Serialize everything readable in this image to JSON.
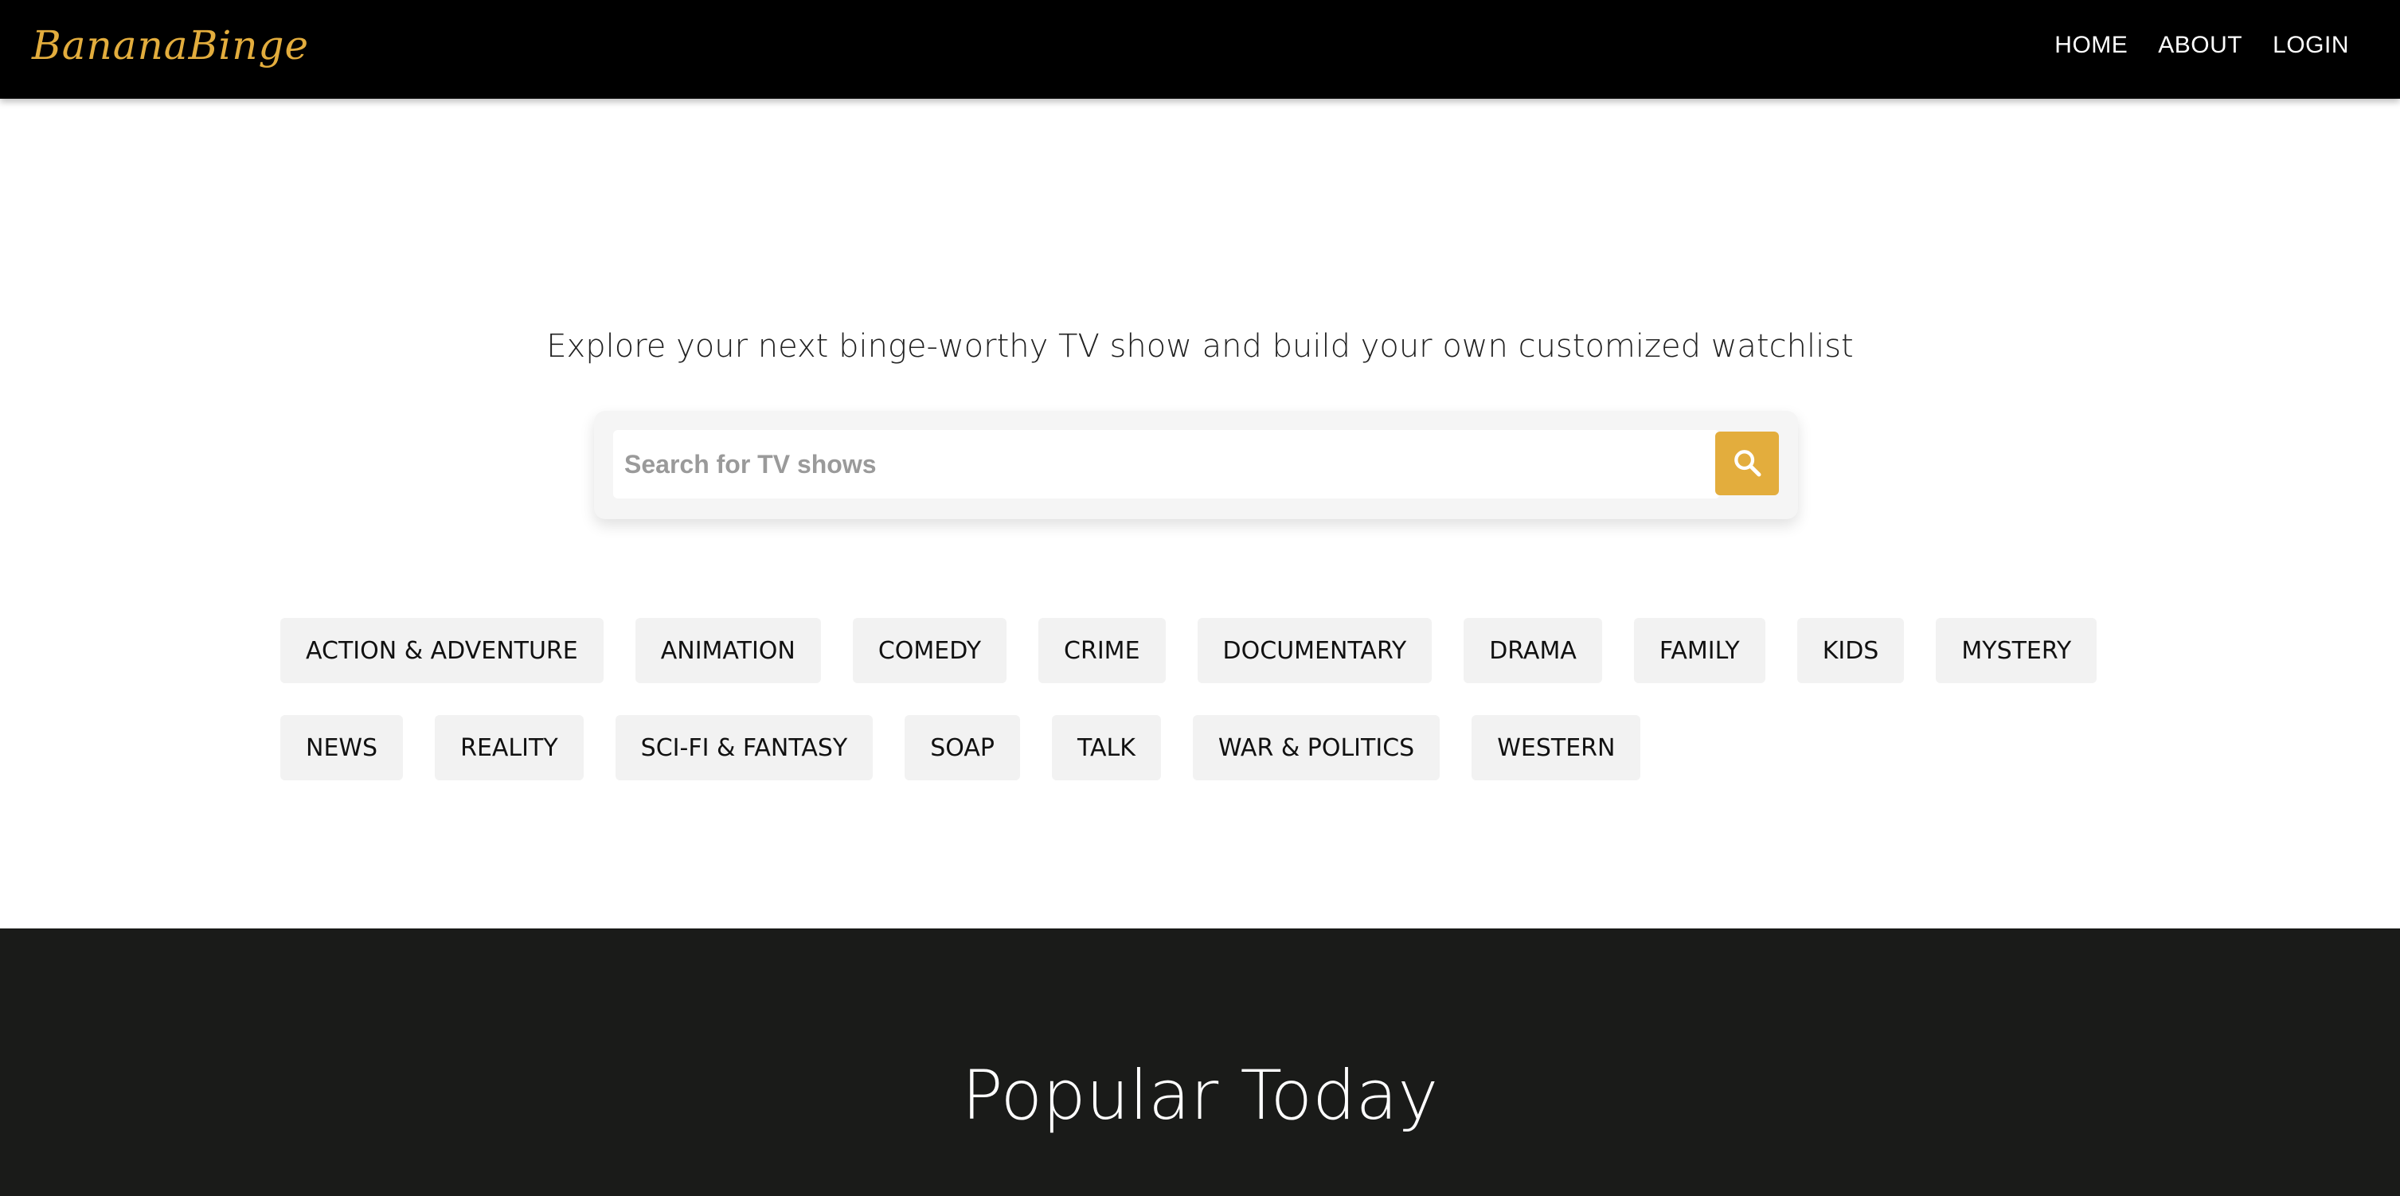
{
  "header": {
    "logo_text": "BananaBinge",
    "nav": [
      {
        "label": "HOME"
      },
      {
        "label": "ABOUT"
      },
      {
        "label": "LOGIN"
      }
    ]
  },
  "hero": {
    "tagline": "Explore your next binge-worthy TV show and build your own customized watchlist",
    "search": {
      "placeholder": "Search for TV shows",
      "value": "",
      "button_icon": "search-icon"
    }
  },
  "genres": {
    "row1": [
      "ACTION & ADVENTURE",
      "ANIMATION",
      "COMEDY",
      "CRIME",
      "DOCUMENTARY",
      "DRAMA",
      "FAMILY",
      "KIDS",
      "MYSTERY"
    ],
    "row2": [
      "NEWS",
      "REALITY",
      "SCI-FI & FANTASY",
      "SOAP",
      "TALK",
      "WAR & POLITICS",
      "WESTERN"
    ]
  },
  "popular": {
    "title": "Popular Today"
  },
  "colors": {
    "accent": "#e3ad3d",
    "header_bg": "#000000",
    "section_dark": "#1a1b19",
    "chip_bg": "#f2f2f2"
  }
}
